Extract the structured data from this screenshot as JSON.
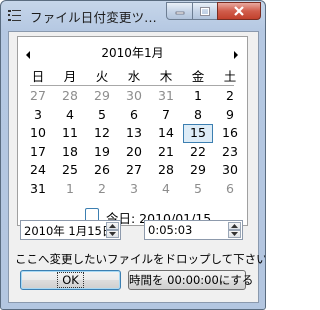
{
  "window": {
    "title": "ファイル日付変更ツ...",
    "controls": {
      "minimize_icon": "minimize-icon",
      "maximize_icon": "maximize-icon",
      "close_icon": "close-icon"
    }
  },
  "calendar": {
    "month_title": "2010年1月",
    "weekdays": [
      "日",
      "月",
      "火",
      "水",
      "木",
      "金",
      "土"
    ],
    "weeks": [
      [
        {
          "d": "27",
          "o": true
        },
        {
          "d": "28",
          "o": true
        },
        {
          "d": "29",
          "o": true
        },
        {
          "d": "30",
          "o": true
        },
        {
          "d": "31",
          "o": true
        },
        {
          "d": "1"
        },
        {
          "d": "2"
        }
      ],
      [
        {
          "d": "3"
        },
        {
          "d": "4"
        },
        {
          "d": "5"
        },
        {
          "d": "6"
        },
        {
          "d": "7"
        },
        {
          "d": "8"
        },
        {
          "d": "9"
        }
      ],
      [
        {
          "d": "10"
        },
        {
          "d": "11"
        },
        {
          "d": "12"
        },
        {
          "d": "13"
        },
        {
          "d": "14"
        },
        {
          "d": "15",
          "sel": true
        },
        {
          "d": "16"
        }
      ],
      [
        {
          "d": "17"
        },
        {
          "d": "18"
        },
        {
          "d": "19"
        },
        {
          "d": "20"
        },
        {
          "d": "21"
        },
        {
          "d": "22"
        },
        {
          "d": "23"
        }
      ],
      [
        {
          "d": "24"
        },
        {
          "d": "25"
        },
        {
          "d": "26"
        },
        {
          "d": "27"
        },
        {
          "d": "28"
        },
        {
          "d": "29"
        },
        {
          "d": "30"
        }
      ],
      [
        {
          "d": "31"
        },
        {
          "d": "1",
          "o": true
        },
        {
          "d": "2",
          "o": true
        },
        {
          "d": "3",
          "o": true
        },
        {
          "d": "4",
          "o": true
        },
        {
          "d": "5",
          "o": true
        },
        {
          "d": "6",
          "o": true
        }
      ]
    ],
    "today_label": "今日: 2010/01/15",
    "selection_color": "#3c7fb1"
  },
  "date_picker": {
    "value": "2010年  1月15日"
  },
  "time_picker": {
    "value": "0:05:03"
  },
  "instruction": "ここへ変更したいファイルをドロップして下さい",
  "buttons": {
    "ok": "OK",
    "reset_time": "時間を 00:00:00にする"
  }
}
